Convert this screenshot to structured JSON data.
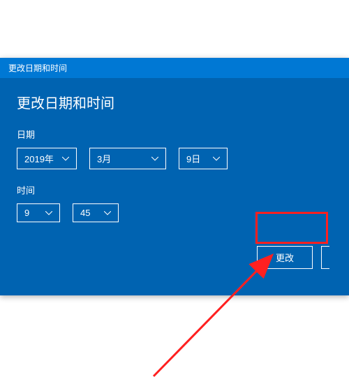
{
  "titlebar": {
    "title": "更改日期和时间"
  },
  "heading": "更改日期和时间",
  "date": {
    "label": "日期",
    "year": "2019年",
    "month": "3月",
    "day": "9日"
  },
  "time": {
    "label": "时间",
    "hour": "9",
    "minute": "45"
  },
  "buttons": {
    "change": "更改"
  }
}
